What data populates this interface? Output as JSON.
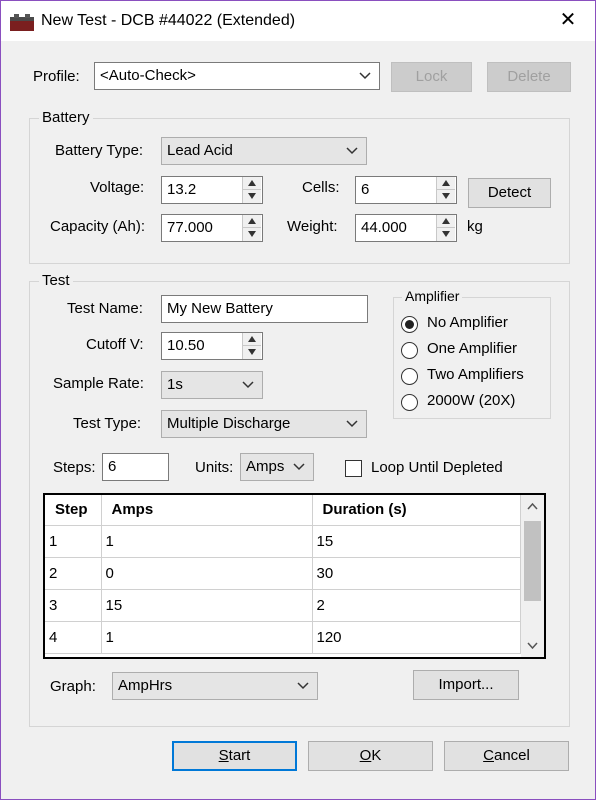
{
  "window": {
    "title": "New Test - DCB #44022 (Extended)",
    "close_glyph": "✕"
  },
  "profile": {
    "label": "Profile:",
    "value": "<Auto-Check>",
    "lock_label": "Lock",
    "delete_label": "Delete"
  },
  "battery": {
    "group_label": "Battery",
    "type_label": "Battery Type:",
    "type_value": "Lead Acid",
    "voltage_label": "Voltage:",
    "voltage_value": "13.2",
    "cells_label": "Cells:",
    "cells_value": "6",
    "detect_label": "Detect",
    "capacity_label": "Capacity (Ah):",
    "capacity_value": "77.000",
    "weight_label": "Weight:",
    "weight_value": "44.000",
    "weight_unit": "kg"
  },
  "test": {
    "group_label": "Test",
    "name_label": "Test Name:",
    "name_value": "My New Battery",
    "cutoff_label": "Cutoff V:",
    "cutoff_value": "10.50",
    "sample_label": "Sample Rate:",
    "sample_value": "1s",
    "type_label": "Test Type:",
    "type_value": "Multiple Discharge",
    "steps_label": "Steps:",
    "steps_value": "6",
    "units_label": "Units:",
    "units_value": "Amps",
    "loop_label": "Loop Until Depleted",
    "loop_checked": false,
    "amplifier": {
      "group_label": "Amplifier",
      "options": [
        "No Amplifier",
        "One Amplifier",
        "Two Amplifiers",
        "2000W (20X)"
      ],
      "selected": "No Amplifier"
    },
    "table": {
      "headers": [
        "Step",
        "Amps",
        "Duration (s)"
      ],
      "rows": [
        [
          "1",
          "1",
          "15"
        ],
        [
          "2",
          "0",
          "30"
        ],
        [
          "3",
          "15",
          "2"
        ],
        [
          "4",
          "1",
          "120"
        ]
      ]
    },
    "graph_label": "Graph:",
    "graph_value": "AmpHrs",
    "import_label": "Import..."
  },
  "footer": {
    "start_label": "Start",
    "start_underline": "S",
    "start_rest": "tart",
    "ok_underline": "O",
    "ok_rest": "K",
    "cancel_underline": "C",
    "cancel_rest": "ancel"
  },
  "colors": {
    "window_border": "#8a4fbf",
    "default_button_border": "#0078d7"
  }
}
